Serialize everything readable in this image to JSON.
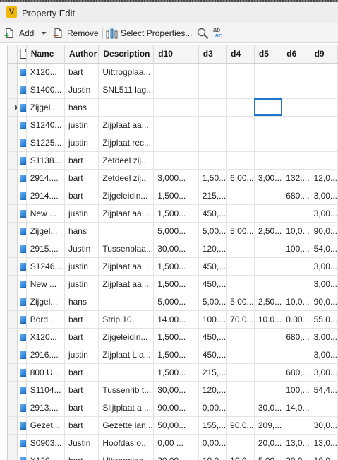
{
  "window": {
    "title": "Property Edit",
    "app_icon_letter": "V"
  },
  "toolbar": {
    "add_label": "Add",
    "remove_label": "Remove",
    "select_properties_label": "Select Properties...",
    "find_replace_glyph_top": "ab",
    "find_replace_glyph_bottom": "ac"
  },
  "grid": {
    "columns": [
      "Name",
      "Author",
      "Description",
      "d10",
      "d3",
      "d4",
      "d5",
      "d6",
      "d9"
    ],
    "rows": [
      [
        "X120...",
        "bart",
        "Uittrogplaa...",
        "",
        "",
        "",
        "",
        "",
        ""
      ],
      [
        "S1400...",
        "Justin",
        "SNL511 lag...",
        "",
        "",
        "",
        "",
        "",
        ""
      ],
      [
        "Zijgel...",
        "hans",
        "",
        "",
        "",
        "",
        "",
        "",
        ""
      ],
      [
        "S1240...",
        "justin",
        "Zijplaat  aa...",
        "",
        "",
        "",
        "",
        "",
        ""
      ],
      [
        "S1225...",
        "justin",
        "Zijplaat rec...",
        "",
        "",
        "",
        "",
        "",
        ""
      ],
      [
        "S1138...",
        "bart",
        "Zetdeel zij...",
        "",
        "",
        "",
        "",
        "",
        ""
      ],
      [
        "2914....",
        "bart",
        "Zetdeel zij...",
        "3,000...",
        "1,50...",
        "6,00...",
        "3,00...",
        "132....",
        "12,0..."
      ],
      [
        "2914....",
        "bart",
        "Zijgeleidin...",
        "1,500...",
        "215,...",
        "",
        "",
        "680,...",
        "3,00..."
      ],
      [
        "New ...",
        "justin",
        "Zijplaat  aa...",
        "1,500...",
        "450,...",
        "",
        "",
        "",
        "3,00..."
      ],
      [
        "Zijgel...",
        "hans",
        "",
        "5,000...",
        "5,00...",
        "5,00...",
        "2,50...",
        "10,0...",
        "90,0..."
      ],
      [
        "2915....",
        "Justin",
        "Tussenplaa...",
        "30,00...",
        "120,...",
        "",
        "",
        "100,...",
        "54,0..."
      ],
      [
        "S1246...",
        "justin",
        "Zijplaat aa...",
        "1,500...",
        "450,...",
        "",
        "",
        "",
        "3,00..."
      ],
      [
        "New ...",
        "justin",
        "Zijplaat  aa...",
        "1,500...",
        "450,...",
        "",
        "",
        "",
        "3,00..."
      ],
      [
        "Zijgel...",
        "hans",
        "",
        "5,000...",
        "5,00...",
        "5,00...",
        "2,50...",
        "10,0...",
        "90,0..."
      ],
      [
        "Bord...",
        "bart",
        "Strip.10",
        "14.00...",
        "100....",
        "70.0...",
        "10.0...",
        "0.00...",
        "55.0..."
      ],
      [
        "X120...",
        "bart",
        "Zijgeleidin...",
        "1,500...",
        "450,...",
        "",
        "",
        "680,...",
        "3,00..."
      ],
      [
        "2916....",
        "justin",
        "Zijplaat L a...",
        "1,500...",
        "450,...",
        "",
        "",
        "",
        "3,00..."
      ],
      [
        "800 U...",
        "bart",
        "",
        "1,500...",
        "215,...",
        "",
        "",
        "680,...",
        "3,00..."
      ],
      [
        "S1104...",
        "bart",
        "Tussenrib t...",
        "30,00...",
        "120,...",
        "",
        "",
        "100,...",
        "54,4..."
      ],
      [
        "2913....",
        "bart",
        "Slijtplaat a...",
        "90,00...",
        "0,00...",
        "",
        "30,0...",
        "14,0...",
        ""
      ],
      [
        "Gezet...",
        "bart",
        "Gezette lan...",
        "50,00...",
        "155,...",
        "90,0...",
        "209,...",
        "",
        "30,0..."
      ],
      [
        "S0903...",
        "Justin",
        "Hoofdas o...",
        "0,00 ...",
        "0,00...",
        "",
        "20,0...",
        "13,0...",
        "13,0..."
      ],
      [
        "X120...",
        "bart",
        "Uittrogplaa...",
        "20,00...",
        "10,0...",
        "10,0...",
        "5,00...",
        "20,0...",
        "10,0..."
      ]
    ]
  }
}
